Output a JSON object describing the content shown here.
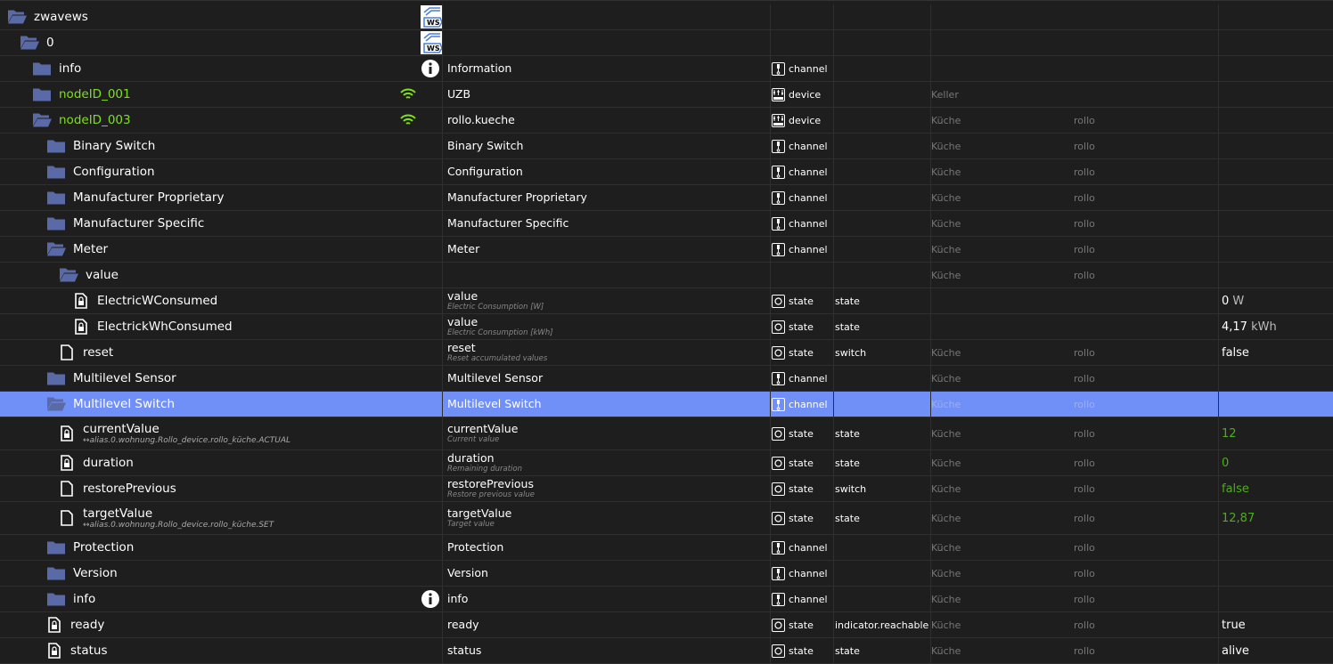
{
  "rows": [
    {
      "level": 0,
      "icon": "folder-open",
      "name": "zwavews",
      "extra": "logo"
    },
    {
      "level": 1,
      "icon": "folder-open",
      "name": "0",
      "extra": "logo"
    },
    {
      "level": 2,
      "icon": "folder",
      "name": "info",
      "extra": "info",
      "title": "Information",
      "type": "channel"
    },
    {
      "level": 2,
      "icon": "folder",
      "name": "nodeID_001",
      "green": true,
      "extra": "wifi",
      "title": "UZB",
      "type": "device",
      "room": "Keller"
    },
    {
      "level": 2,
      "icon": "folder-open",
      "name": "nodeID_003",
      "green": true,
      "extra": "wifi",
      "title": "rollo.kueche",
      "type": "device",
      "room": "Küche",
      "func": "rollo"
    },
    {
      "level": 3,
      "icon": "folder",
      "name": "Binary Switch",
      "title": "Binary Switch",
      "type": "channel",
      "room": "Küche",
      "func": "rollo"
    },
    {
      "level": 3,
      "icon": "folder",
      "name": "Configuration",
      "title": "Configuration",
      "type": "channel",
      "room": "Küche",
      "func": "rollo"
    },
    {
      "level": 3,
      "icon": "folder",
      "name": "Manufacturer Proprietary",
      "title": "Manufacturer Proprietary",
      "type": "channel",
      "room": "Küche",
      "func": "rollo"
    },
    {
      "level": 3,
      "icon": "folder",
      "name": "Manufacturer Specific",
      "title": "Manufacturer Specific",
      "type": "channel",
      "room": "Küche",
      "func": "rollo"
    },
    {
      "level": 3,
      "icon": "folder-open",
      "name": "Meter",
      "title": "Meter",
      "type": "channel",
      "room": "Küche",
      "func": "rollo"
    },
    {
      "level": 4,
      "icon": "folder-open",
      "name": "value",
      "room": "Küche",
      "func": "rollo"
    },
    {
      "level": 5,
      "icon": "file-lock",
      "name": "ElectricWConsumed",
      "title": "value",
      "desc": "Electric Consumption [W]",
      "type": "state",
      "role": "state",
      "value": "0",
      "unit": "W"
    },
    {
      "level": 5,
      "icon": "file-lock",
      "name": "ElectrickWhConsumed",
      "title": "value",
      "desc": "Electric Consumption [kWh]",
      "type": "state",
      "role": "state",
      "value": "4,17",
      "unit": "kWh"
    },
    {
      "level": 4,
      "icon": "file",
      "name": "reset",
      "title": "reset",
      "desc": "Reset accumulated values",
      "type": "state",
      "role": "switch",
      "room": "Küche",
      "func": "rollo",
      "value": "false"
    },
    {
      "level": 3,
      "icon": "folder",
      "name": "Multilevel Sensor",
      "title": "Multilevel Sensor",
      "type": "channel",
      "room": "Küche",
      "func": "rollo"
    },
    {
      "level": 3,
      "icon": "folder-open",
      "name": "Multilevel Switch",
      "selected": true,
      "title": "Multilevel Switch",
      "type": "channel",
      "room": "Küche",
      "func": "rollo"
    },
    {
      "level": 4,
      "icon": "file-lock",
      "name": "currentValue",
      "alias": "↔alias.0.wohnung.Rollo_device.rollo_küche.ACTUAL",
      "title": "currentValue",
      "desc": "Current value",
      "type": "state",
      "role": "state",
      "room": "Küche",
      "func": "rollo",
      "value": "12",
      "valueGreen": true
    },
    {
      "level": 4,
      "icon": "file-lock",
      "name": "duration",
      "title": "duration",
      "desc": "Remaining duration",
      "type": "state",
      "role": "state",
      "room": "Küche",
      "func": "rollo",
      "value": "0",
      "valueGreen": true
    },
    {
      "level": 4,
      "icon": "file",
      "name": "restorePrevious",
      "title": "restorePrevious",
      "desc": "Restore previous value",
      "type": "state",
      "role": "switch",
      "room": "Küche",
      "func": "rollo",
      "value": "false",
      "valueGreen": true
    },
    {
      "level": 4,
      "icon": "file",
      "name": "targetValue",
      "alias": "↔alias.0.wohnung.Rollo_device.rollo_küche.SET",
      "title": "targetValue",
      "desc": "Target value",
      "type": "state",
      "role": "state",
      "room": "Küche",
      "func": "rollo",
      "value": "12,87",
      "valueGreen": true
    },
    {
      "level": 3,
      "icon": "folder",
      "name": "Protection",
      "title": "Protection",
      "type": "channel",
      "room": "Küche",
      "func": "rollo"
    },
    {
      "level": 3,
      "icon": "folder",
      "name": "Version",
      "title": "Version",
      "type": "channel",
      "room": "Küche",
      "func": "rollo"
    },
    {
      "level": 3,
      "icon": "folder",
      "name": "info",
      "extra": "info",
      "title": "info",
      "type": "channel",
      "room": "Küche",
      "func": "rollo"
    },
    {
      "level": 3,
      "icon": "file-lock",
      "name": "ready",
      "title": "ready",
      "type": "state",
      "role": "indicator.reachable",
      "room": "Küche",
      "func": "rollo",
      "value": "true"
    },
    {
      "level": 3,
      "icon": "file-lock",
      "name": "status",
      "title": "status",
      "type": "state",
      "role": "state",
      "room": "Küche",
      "func": "rollo",
      "value": "alive"
    }
  ],
  "colors": {
    "folder": "#5a6aa6",
    "green": "#7ee01c",
    "valueGreen": "#4caf1a",
    "selected": "#7190f7"
  }
}
